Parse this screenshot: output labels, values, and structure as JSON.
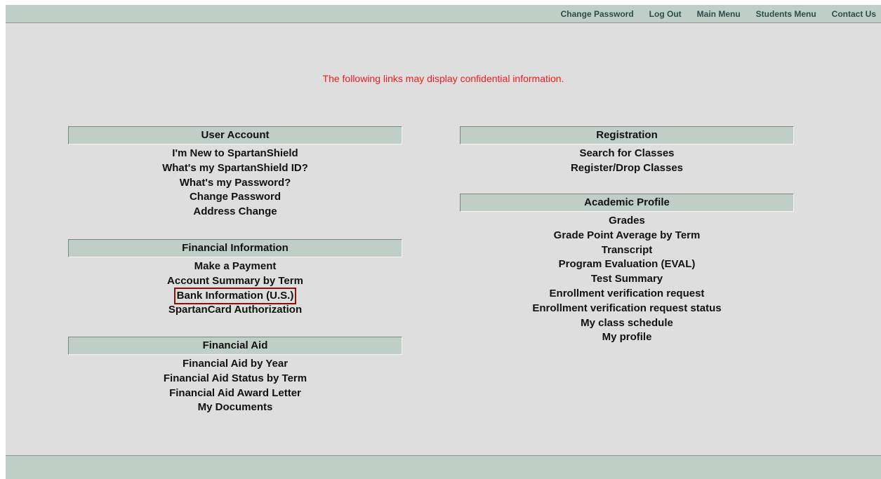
{
  "topnav": {
    "links": [
      "Change Password",
      "Log Out",
      "Main Menu",
      "Students Menu",
      "Contact Us"
    ]
  },
  "notice": "The following links may display confidential information.",
  "sections": {
    "user_account": {
      "title": "User Account",
      "links": [
        "I'm New to SpartanShield",
        "What's my SpartanShield ID?",
        "What's my Password?",
        "Change Password",
        "Address Change"
      ]
    },
    "financial_information": {
      "title": "Financial Information",
      "links": [
        "Make a Payment",
        "Account Summary by Term",
        "Bank Information (U.S.)",
        "SpartanCard Authorization"
      ]
    },
    "financial_aid": {
      "title": "Financial Aid",
      "links": [
        "Financial Aid by Year",
        "Financial Aid Status by Term",
        "Financial Aid Award Letter",
        "My Documents"
      ]
    },
    "registration": {
      "title": "Registration",
      "links": [
        "Search for Classes",
        "Register/Drop Classes"
      ]
    },
    "academic_profile": {
      "title": "Academic Profile",
      "links": [
        "Grades",
        "Grade Point Average by Term",
        "Transcript",
        "Program Evaluation (EVAL)",
        "Test Summary",
        "Enrollment verification request",
        "Enrollment verification request status",
        "My class schedule",
        "My profile"
      ]
    }
  },
  "colors": {
    "header_bg": "#bfcfc8",
    "page_bg": "#dedede",
    "notice_text": "#f21c1c",
    "highlight_border": "#8a1010"
  }
}
